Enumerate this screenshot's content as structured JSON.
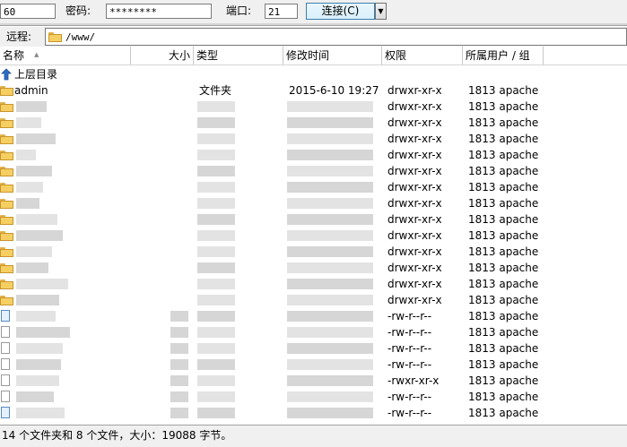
{
  "connection": {
    "host_value": "60",
    "password_label": "密码:",
    "password_value": "********",
    "port_label": "端口:",
    "port_value": "21",
    "connect_label": "连接(C)",
    "dropdown_glyph": "▼"
  },
  "path": {
    "label": "远程:",
    "value": "/www/"
  },
  "columns": {
    "name": "名称",
    "size": "大小",
    "type": "类型",
    "modified": "修改时间",
    "permissions": "权限",
    "owner": "所属用户 / 组"
  },
  "rows": [
    {
      "kind": "up",
      "name": "上层目录",
      "type": "",
      "date": "",
      "perm": "",
      "owner": ""
    },
    {
      "kind": "folder",
      "name": "admin",
      "type": "文件夹",
      "date": "2015-6-10 19:27",
      "perm": "drwxr-xr-x",
      "owner": "1813 apache"
    },
    {
      "kind": "folder",
      "name": "",
      "type": "",
      "date": "",
      "perm": "drwxr-xr-x",
      "owner": "1813 apache"
    },
    {
      "kind": "folder",
      "name": "",
      "type": "",
      "date": "",
      "perm": "drwxr-xr-x",
      "owner": "1813 apache"
    },
    {
      "kind": "folder",
      "name": "",
      "type": "",
      "date": "",
      "perm": "drwxr-xr-x",
      "owner": "1813 apache"
    },
    {
      "kind": "folder",
      "name": "",
      "type": "",
      "date": "",
      "perm": "drwxr-xr-x",
      "owner": "1813 apache"
    },
    {
      "kind": "folder",
      "name": "",
      "type": "",
      "date": "",
      "perm": "drwxr-xr-x",
      "owner": "1813 apache"
    },
    {
      "kind": "folder",
      "name": "",
      "type": "",
      "date": "",
      "perm": "drwxr-xr-x",
      "owner": "1813 apache"
    },
    {
      "kind": "folder",
      "name": "",
      "type": "",
      "date": "",
      "perm": "drwxr-xr-x",
      "owner": "1813 apache"
    },
    {
      "kind": "folder",
      "name": "",
      "type": "",
      "date": "",
      "perm": "drwxr-xr-x",
      "owner": "1813 apache"
    },
    {
      "kind": "folder",
      "name": "",
      "type": "",
      "date": "",
      "perm": "drwxr-xr-x",
      "owner": "1813 apache"
    },
    {
      "kind": "folder",
      "name": "",
      "type": "",
      "date": "",
      "perm": "drwxr-xr-x",
      "owner": "1813 apache"
    },
    {
      "kind": "folder",
      "name": "",
      "type": "",
      "date": "",
      "perm": "drwxr-xr-x",
      "owner": "1813 apache"
    },
    {
      "kind": "folder",
      "name": "",
      "type": "",
      "date": "",
      "perm": "drwxr-xr-x",
      "owner": "1813 apache"
    },
    {
      "kind": "folder",
      "name": "",
      "type": "",
      "date": "",
      "perm": "drwxr-xr-x",
      "owner": "1813 apache"
    },
    {
      "kind": "file",
      "name": "",
      "type": "",
      "date": "",
      "perm": "-rw-r--r--",
      "owner": "1813 apache"
    },
    {
      "kind": "file",
      "name": "",
      "type": "",
      "date": "",
      "perm": "-rw-r--r--",
      "owner": "1813 apache"
    },
    {
      "kind": "file",
      "name": "",
      "type": "",
      "date": "",
      "perm": "-rw-r--r--",
      "owner": "1813 apache"
    },
    {
      "kind": "file",
      "name": "",
      "type": "",
      "date": "",
      "perm": "-rw-r--r--",
      "owner": "1813 apache"
    },
    {
      "kind": "file",
      "name": "",
      "type": "",
      "date": "",
      "perm": "-rwxr-xr-x",
      "owner": "1813 apache"
    },
    {
      "kind": "file",
      "name": "",
      "type": "",
      "date": "",
      "perm": "-rw-r--r--",
      "owner": "1813 apache"
    },
    {
      "kind": "file",
      "name": "",
      "type": "",
      "date": "",
      "perm": "-rw-r--r--",
      "owner": "1813 apache"
    }
  ],
  "status": {
    "text": "14 个文件夹和 8 个文件，大小：19088 字节。"
  },
  "colors": {
    "folder": "#f6cf62",
    "chrome": "#f0f0f0",
    "connect_accent": "#3c7fb1"
  }
}
